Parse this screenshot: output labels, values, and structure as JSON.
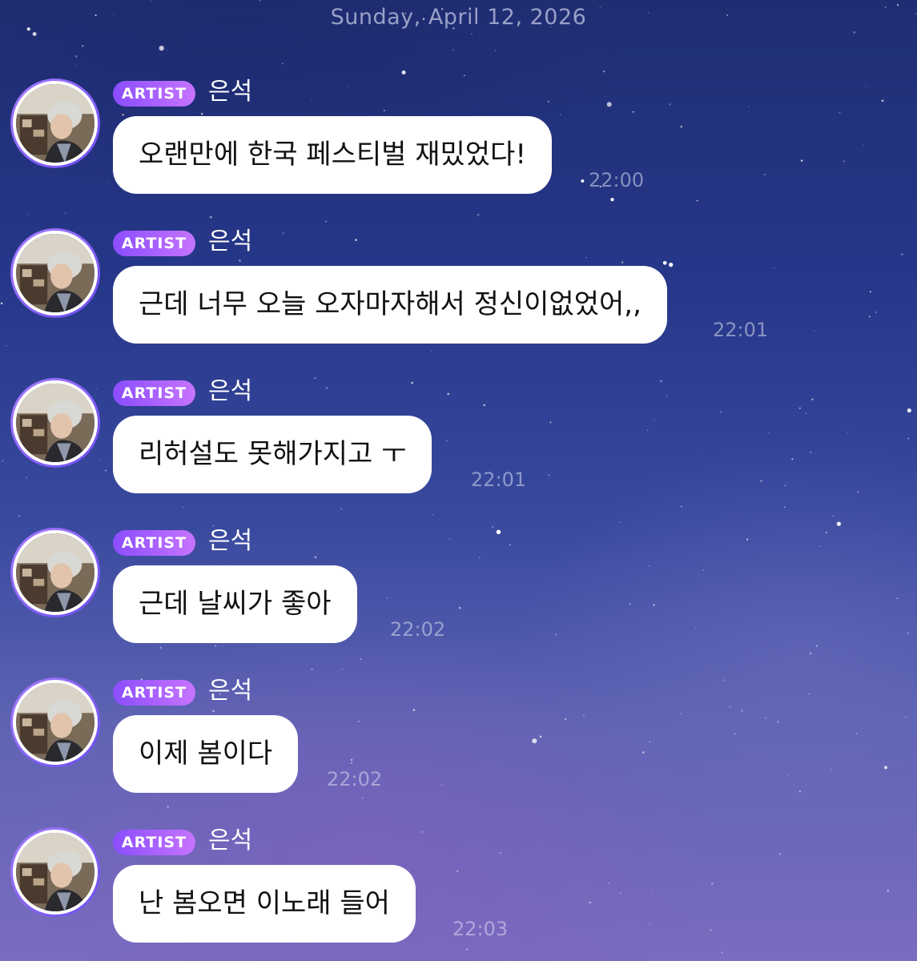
{
  "chat": {
    "date_label": "Sunday, April 12, 2026",
    "accent_color": "#8a4dff",
    "messages": [
      {
        "badge": "ARTIST",
        "sender": "은석",
        "text": "오랜만에 한국 페스티벌 재밌었다!",
        "time": "22:00"
      },
      {
        "badge": "ARTIST",
        "sender": "은석",
        "text": "근데 너무 오늘 오자마자해서 정신이없었어,,",
        "time": "22:01"
      },
      {
        "badge": "ARTIST",
        "sender": "은석",
        "text": "리허설도 못해가지고 ㅜ",
        "time": "22:01"
      },
      {
        "badge": "ARTIST",
        "sender": "은석",
        "text": "근데 날씨가 좋아",
        "time": "22:02"
      },
      {
        "badge": "ARTIST",
        "sender": "은석",
        "text": "이제 봄이다",
        "time": "22:02"
      },
      {
        "badge": "ARTIST",
        "sender": "은석",
        "text": "난 봄오면 이노래 들어",
        "time": "22:03"
      }
    ]
  }
}
